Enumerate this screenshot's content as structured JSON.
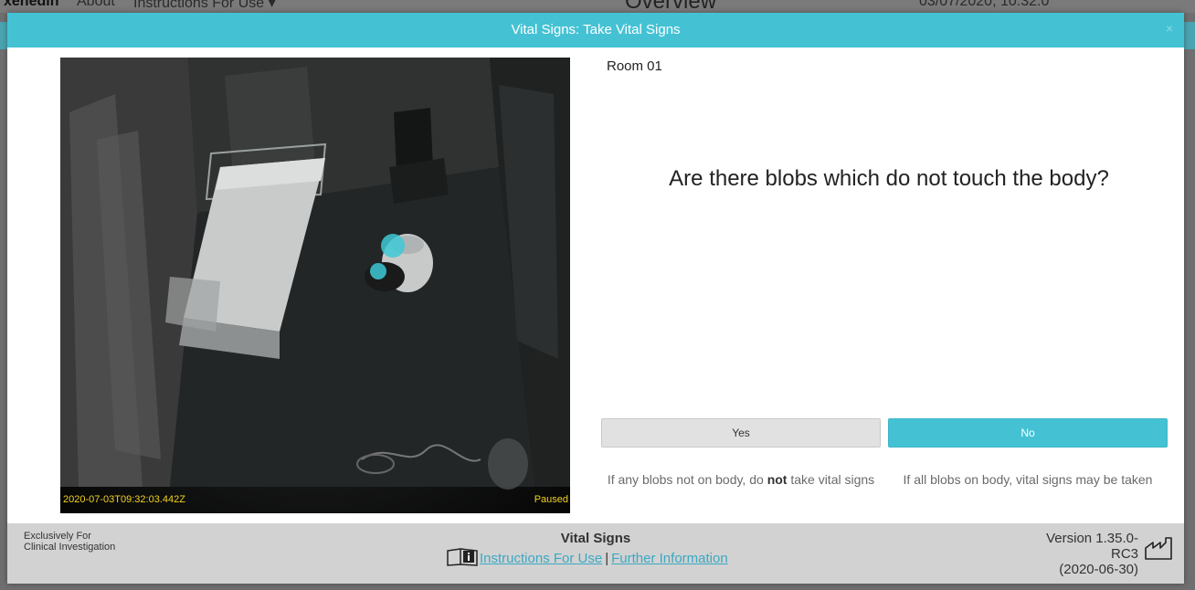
{
  "background": {
    "brand": "xenedin",
    "about": "About",
    "ifu_menu": "Instructions For Use ▾",
    "title": "Overview",
    "datetime": "03/07/2020, 10:32:0"
  },
  "modal": {
    "title": "Vital Signs: Take Vital Signs",
    "close_label": "×"
  },
  "video": {
    "timestamp": "2020-07-03T09:32:03.442Z",
    "status": "Paused"
  },
  "room": "Room 01",
  "question": "Are there blobs which do not touch the body?",
  "buttons": {
    "yes": "Yes",
    "no": "No"
  },
  "hints": {
    "yes_prefix": "If any blobs not on body, do ",
    "yes_emph": "not",
    "yes_suffix": " take vital signs",
    "no": "If all blobs on body, vital signs may be taken"
  },
  "footer": {
    "left_line1": "Exclusively For",
    "left_line2": "Clinical Investigation",
    "title": "Vital Signs",
    "ifu_link": "Instructions For Use",
    "separator": "|",
    "info_link": "Further Information",
    "version_line1": "Version 1.35.0-",
    "version_line2": "RC3",
    "version_line3": "(2020-06-30)"
  },
  "colors": {
    "accent": "#44c2d4",
    "timestamp": "#f2d21f",
    "link": "#3aa9c3"
  },
  "icons": [
    "book-info-icon",
    "factory-icon",
    "close-icon"
  ]
}
